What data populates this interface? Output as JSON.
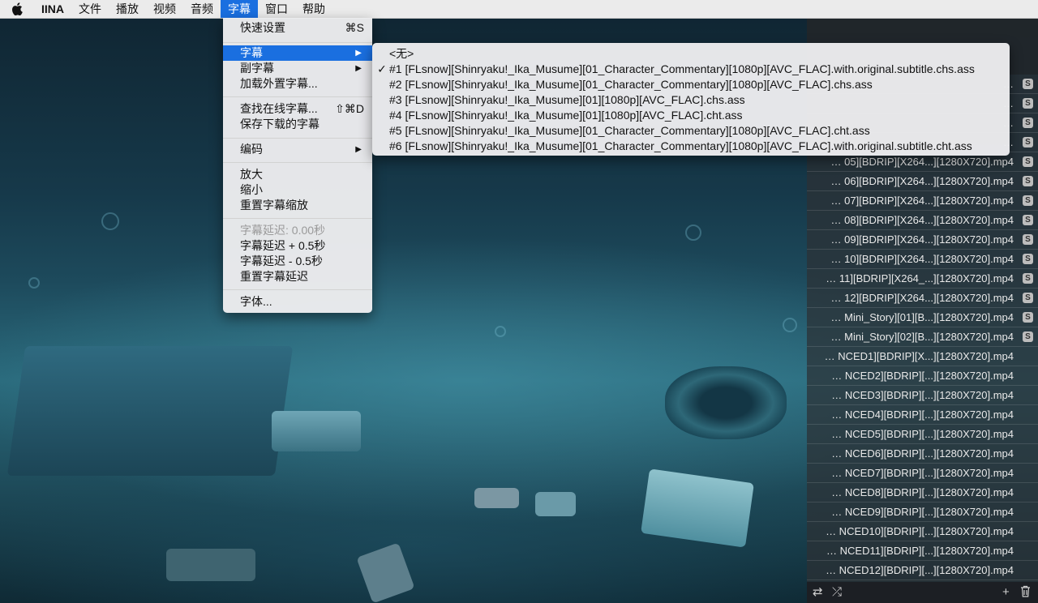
{
  "menubar": {
    "apple_icon": "apple-logo-icon",
    "items": [
      "IINA",
      "文件",
      "播放",
      "视频",
      "音频",
      "字幕",
      "窗口",
      "帮助"
    ],
    "active_index": 5
  },
  "menu": {
    "quick_settings": {
      "label": "快速设置",
      "shortcut": "⌘S"
    },
    "subtitle": {
      "label": "字幕"
    },
    "secondary_subtitle": {
      "label": "副字幕"
    },
    "load_external": {
      "label": "加载外置字幕..."
    },
    "find_online": {
      "label": "查找在线字幕...",
      "shortcut": "⇧⌘D"
    },
    "save_downloaded": {
      "label": "保存下载的字幕"
    },
    "encoding": {
      "label": "编码"
    },
    "zoom_in": {
      "label": "放大"
    },
    "zoom_out": {
      "label": "缩小"
    },
    "reset_scale": {
      "label": "重置字幕缩放"
    },
    "delay_display": {
      "label": "字幕延迟: 0.00秒"
    },
    "delay_plus": {
      "label": "字幕延迟 + 0.5秒"
    },
    "delay_minus": {
      "label": "字幕延迟 - 0.5秒"
    },
    "reset_delay": {
      "label": "重置字幕延迟"
    },
    "font": {
      "label": "字体..."
    }
  },
  "submenu": {
    "items": [
      {
        "label": "<无>",
        "checked": false
      },
      {
        "label": "#1 [FLsnow][Shinryaku!_Ika_Musume][01_Character_Commentary][1080p][AVC_FLAC].with.original.subtitle.chs.ass",
        "checked": true
      },
      {
        "label": "#2 [FLsnow][Shinryaku!_Ika_Musume][01_Character_Commentary][1080p][AVC_FLAC].chs.ass",
        "checked": false
      },
      {
        "label": "#3 [FLsnow][Shinryaku!_Ika_Musume][01][1080p][AVC_FLAC].chs.ass",
        "checked": false
      },
      {
        "label": "#4 [FLsnow][Shinryaku!_Ika_Musume][01][1080p][AVC_FLAC].cht.ass",
        "checked": false
      },
      {
        "label": "#5 [FLsnow][Shinryaku!_Ika_Musume][01_Character_Commentary][1080p][AVC_FLAC].cht.ass",
        "checked": false
      },
      {
        "label": "#6 [FLsnow][Shinryaku!_Ika_Musume][01_Character_Commentary][1080p][AVC_FLAC].with.original.subtitle.cht.ass",
        "checked": false
      }
    ],
    "check_mark": "✓"
  },
  "playlist": {
    "rows": [
      {
        "name": "…",
        "sub": true
      },
      {
        "name": "…",
        "sub": true
      },
      {
        "name": "…",
        "sub": true
      },
      {
        "name": "…",
        "sub": true
      },
      {
        "name": "… 05][BDRIP][X264...][1280X720].mp4",
        "sub": true
      },
      {
        "name": "… 06][BDRIP][X264...][1280X720].mp4",
        "sub": true
      },
      {
        "name": "… 07][BDRIP][X264...][1280X720].mp4",
        "sub": true
      },
      {
        "name": "… 08][BDRIP][X264...][1280X720].mp4",
        "sub": true
      },
      {
        "name": "… 09][BDRIP][X264...][1280X720].mp4",
        "sub": true
      },
      {
        "name": "… 10][BDRIP][X264...][1280X720].mp4",
        "sub": true
      },
      {
        "name": "… 11][BDRIP][X264_...][1280X720].mp4",
        "sub": true
      },
      {
        "name": "… 12][BDRIP][X264...][1280X720].mp4",
        "sub": true
      },
      {
        "name": "… Mini_Story][01][B...][1280X720].mp4",
        "sub": true
      },
      {
        "name": "… Mini_Story][02][B...][1280X720].mp4",
        "sub": true
      },
      {
        "name": "… NCED1][BDRIP][X...][1280X720].mp4",
        "sub": false
      },
      {
        "name": "… NCED2][BDRIP][...][1280X720].mp4",
        "sub": false
      },
      {
        "name": "… NCED3][BDRIP][...][1280X720].mp4",
        "sub": false
      },
      {
        "name": "… NCED4][BDRIP][...][1280X720].mp4",
        "sub": false
      },
      {
        "name": "… NCED5][BDRIP][...][1280X720].mp4",
        "sub": false
      },
      {
        "name": "… NCED6][BDRIP][...][1280X720].mp4",
        "sub": false
      },
      {
        "name": "… NCED7][BDRIP][...][1280X720].mp4",
        "sub": false
      },
      {
        "name": "… NCED8][BDRIP][...][1280X720].mp4",
        "sub": false
      },
      {
        "name": "… NCED9][BDRIP][...][1280X720].mp4",
        "sub": false
      },
      {
        "name": "… NCED10][BDRIP][...][1280X720].mp4",
        "sub": false
      },
      {
        "name": "… NCED11][BDRIP][...][1280X720].mp4",
        "sub": false
      },
      {
        "name": "… NCED12][BDRIP][...][1280X720].mp4",
        "sub": false
      }
    ],
    "sub_badge": "S",
    "footer": {
      "repeat_icon": "⇄",
      "shuffle_icon": "⤮",
      "add_icon": "+",
      "trash_icon": "🗑"
    }
  }
}
